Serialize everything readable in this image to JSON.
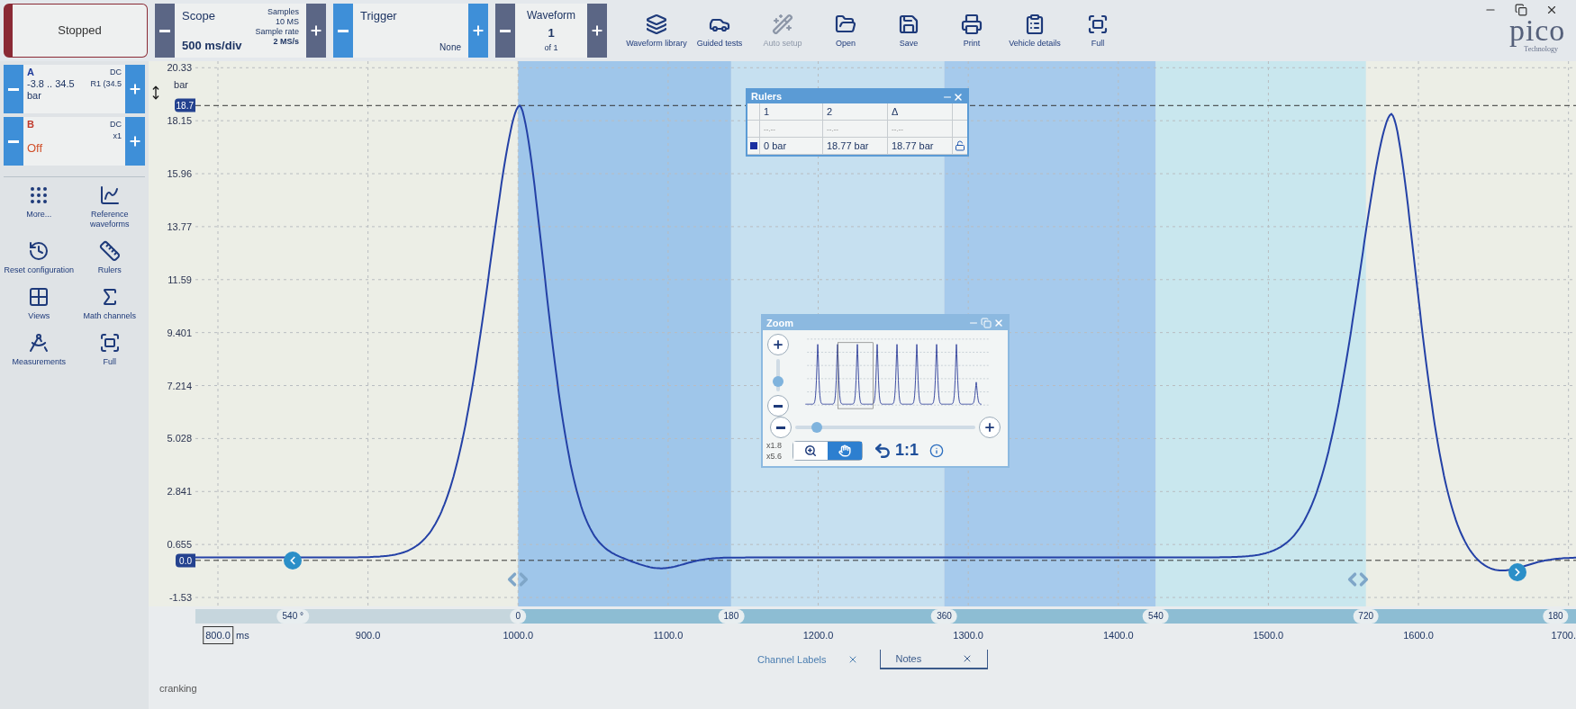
{
  "status_button": {
    "label": "Stopped"
  },
  "scope": {
    "title": "Scope",
    "timebase": "500 ms/div",
    "samples_label": "Samples",
    "samples": "10 MS",
    "rate_label": "Sample rate",
    "rate": "2 MS/s"
  },
  "trigger": {
    "title": "Trigger",
    "mode": "None"
  },
  "waveform_nav": {
    "title": "Waveform",
    "current": "1",
    "total": "of 1"
  },
  "toolbar": [
    {
      "label": "Waveform library",
      "disabled": false
    },
    {
      "label": "Guided tests",
      "disabled": false
    },
    {
      "label": "Auto setup",
      "disabled": true
    },
    {
      "label": "Open",
      "disabled": false
    },
    {
      "label": "Save",
      "disabled": false
    },
    {
      "label": "Print",
      "disabled": false
    },
    {
      "label": "Vehicle details",
      "disabled": false
    },
    {
      "label": "Full",
      "disabled": false
    }
  ],
  "logo": {
    "name": "pico",
    "tagline": "Technology"
  },
  "channels": [
    {
      "name": "A",
      "color": "#1f3b9a",
      "coupling": "DC",
      "probe": "R1 (34.5",
      "range": "-3.8 .. 34.5",
      "unit": "bar",
      "enabled": true
    },
    {
      "name": "B",
      "color": "#c0392b",
      "coupling": "DC",
      "probe": "x1",
      "status": "Off",
      "enabled": false
    }
  ],
  "tools": [
    "More...",
    "Reference waveforms",
    "Reset configuration",
    "Rulers",
    "Views",
    "Math channels",
    "Measurements",
    "Full"
  ],
  "y_axis": {
    "labels": [
      "20.33",
      "18.15",
      "15.96",
      "13.77",
      "11.59",
      "9.401",
      "7.214",
      "5.028",
      "2.841",
      "0.655",
      "-1.53"
    ],
    "unit": "bar",
    "ruler_marker": "18.7",
    "zero_marker": "0.0"
  },
  "x_axis": {
    "labels": [
      "800.0",
      "900.0",
      "1000.0",
      "1100.0",
      "1200.0",
      "1300.0",
      "1400.0",
      "1500.0",
      "1600.0",
      "1700."
    ],
    "unit": "ms"
  },
  "degree_axis": {
    "labels": [
      "540 °",
      "0",
      "180",
      "360",
      "540",
      "720",
      "180"
    ]
  },
  "bands": [
    {
      "color": "#9fc6ea"
    },
    {
      "color": "#c6e0f0"
    },
    {
      "color": "#a6caec"
    },
    {
      "color": "#c9e7ee"
    }
  ],
  "rulers_window": {
    "title": "Rulers",
    "columns": [
      "1",
      "2",
      "Δ"
    ],
    "rows": [
      [
        "--.--",
        "--.--",
        "--.--"
      ],
      [
        "0 bar",
        "18.77 bar",
        "18.77 bar"
      ]
    ]
  },
  "zoom_window": {
    "title": "Zoom",
    "scale_x": "x1.8",
    "scale_y": "x5.6",
    "reset": "1:1",
    "vertical": {
      "level": 0.3
    },
    "horizontal": {
      "level": 0.12
    },
    "modes": [
      {
        "kind": "zoom",
        "selected": false
      },
      {
        "kind": "pan",
        "selected": true
      }
    ]
  },
  "bottom_tabs": [
    {
      "label": "Channel Labels",
      "selected": false
    },
    {
      "label": "Notes",
      "selected": true
    }
  ],
  "notes": {
    "text": "cranking"
  }
}
